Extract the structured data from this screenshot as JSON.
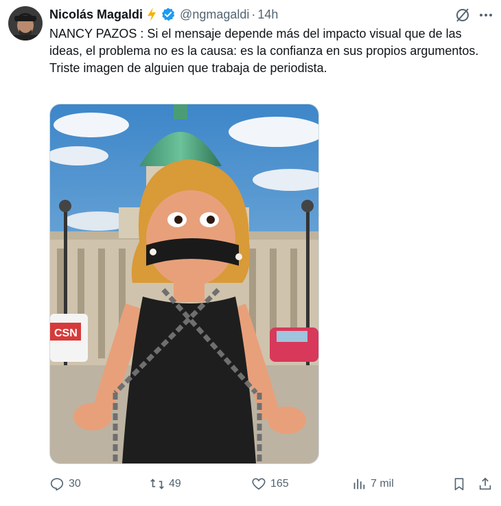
{
  "author": {
    "display_name": "Nicolás Magaldi",
    "handle": "@ngmagaldi",
    "separator": "·",
    "time": "14h"
  },
  "tweet": {
    "lines": [
      "NANCY PAZOS : Si el mensaje depende más del impacto visual que de las ideas, el problema no es la causa: es la confianza en sus propios argumentos.",
      "Triste imagen de alguien que trabaja de periodista."
    ]
  },
  "media": {
    "sign_text": "CSN"
  },
  "actions": {
    "replies": "30",
    "reposts": "49",
    "likes": "165",
    "views": "7 mil"
  },
  "colors": {
    "text": "#0f1419",
    "secondary": "#536471",
    "verified": "#1d9bf0",
    "bolt": "#f4b400"
  },
  "icons": [
    "verified-badge-icon",
    "lightning-icon",
    "grok-icon",
    "more-icon",
    "reply-icon",
    "repost-icon",
    "like-icon",
    "views-icon",
    "bookmark-icon",
    "share-icon"
  ]
}
